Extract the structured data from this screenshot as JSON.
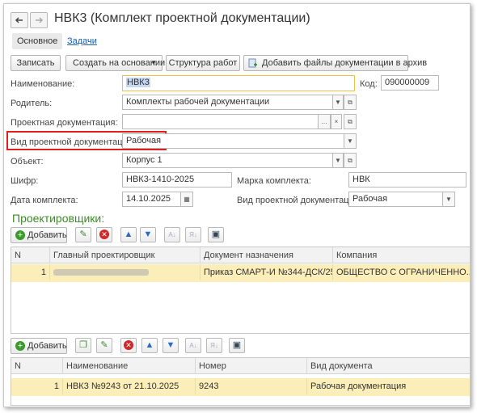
{
  "window": {
    "title": "НВК3 (Комплект проектной документации)"
  },
  "tabs": [
    {
      "label": "Основное"
    },
    {
      "label": "Задачи"
    }
  ],
  "toolbar": {
    "write": "Записать",
    "create_based": "Создать на основании",
    "structure": "Структура работ",
    "add_files": "Добавить файлы документации в архив"
  },
  "form": {
    "name_label": "Наименование:",
    "name_value": "НВК3",
    "code_label": "Код:",
    "code_value": "090000009",
    "parent_label": "Родитель:",
    "parent_value": "Комплекты рабочей документации",
    "project_doc_label": "Проектная документация:",
    "project_doc_value": "",
    "doc_kind_label": "Вид проектной документации:",
    "doc_kind_value": "Рабочая",
    "object_label": "Объект:",
    "object_value": "Корпус 1",
    "cipher_label": "Шифр:",
    "cipher_value": "НВК3-1410-2025",
    "mark_label": "Марка комплекта:",
    "mark_value": "НВК",
    "date_label": "Дата комплекта:",
    "date_value": "14.10.2025",
    "doc_kind2_label": "Вид проектной документации:",
    "doc_kind2_value": "Рабочая"
  },
  "designers": {
    "title": "Проектировщики:",
    "add_label": "Добавить",
    "columns": [
      "N",
      "Главный проектировщик",
      "Документ назначения",
      "Компания"
    ],
    "rows": [
      {
        "n": "1",
        "chief": "",
        "doc": "Приказ СМАРТ-И №344-ДСК/25 ...",
        "company": "ОБЩЕСТВО С ОГРАНИЧЕННО..."
      }
    ]
  },
  "documents": {
    "add_label": "Добавить",
    "columns": [
      "N",
      "Наименование",
      "Номер",
      "Вид документа"
    ],
    "rows": [
      {
        "n": "1",
        "name": "НВК3 №9243 от 21.10.2025",
        "number": "9243",
        "kind": "Рабочая документация"
      }
    ]
  },
  "colors": {
    "section_title": "#3b8c24",
    "highlight_border": "#e02020",
    "selected_row": "#fbeeb8",
    "name_focus": "#f0c040"
  }
}
